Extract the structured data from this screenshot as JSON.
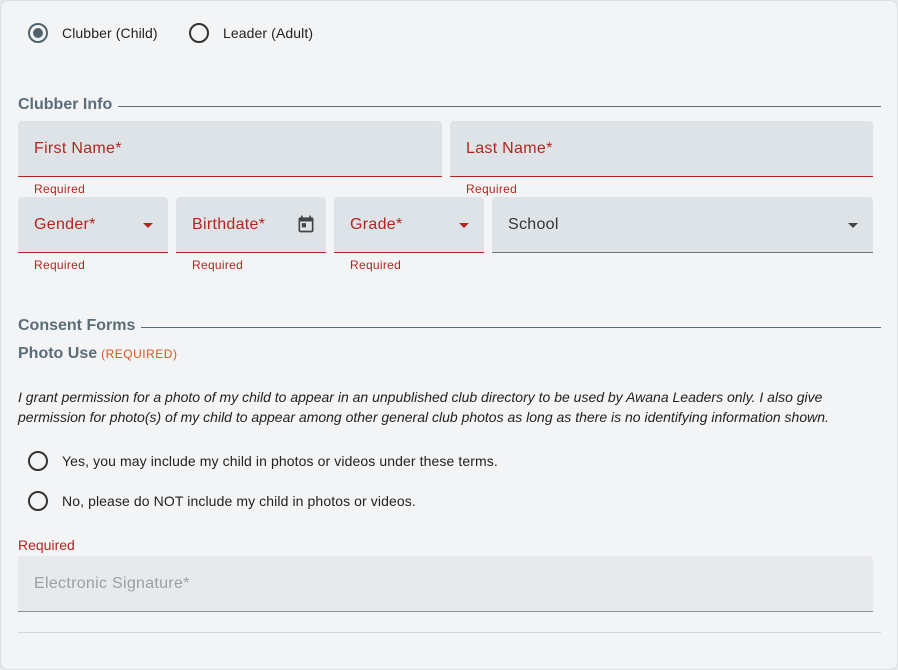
{
  "member_type": {
    "options": [
      {
        "label": "Clubber (Child)",
        "selected": true
      },
      {
        "label": "Leader (Adult)",
        "selected": false
      }
    ]
  },
  "clubber_info": {
    "title": "Clubber Info",
    "first_name": {
      "label": "First Name*",
      "helper": "Required"
    },
    "last_name": {
      "label": "Last Name*",
      "helper": "Required"
    },
    "gender": {
      "label": "Gender*",
      "helper": "Required"
    },
    "birthdate": {
      "label": "Birthdate*",
      "helper": "Required"
    },
    "grade": {
      "label": "Grade*",
      "helper": "Required"
    },
    "school": {
      "label": "School"
    }
  },
  "consent_forms": {
    "title": "Consent Forms",
    "photo_use": {
      "title": "Photo Use",
      "required_tag": "(REQUIRED)",
      "text": "I grant permission for a photo of my child to appear in an unpublished club directory to be used by Awana Leaders only. I also give permission for photo(s) of my child to appear among other general club photos as long as there is no identifying information shown.",
      "options": [
        {
          "label": "Yes, you may include my child in photos or videos under these terms.",
          "selected": false
        },
        {
          "label": "No, please do NOT include my child in photos or videos.",
          "selected": false
        }
      ],
      "required_message": "Required"
    },
    "signature": {
      "label": "Electronic Signature*"
    }
  },
  "colors": {
    "error": "#b3261e",
    "accent": "#5a6d78",
    "required_tag": "#d9541e",
    "field_bg": "#dee3e8"
  },
  "icons": {
    "birthdate": "calendar-icon",
    "dropdown": "caret-down-icon"
  }
}
